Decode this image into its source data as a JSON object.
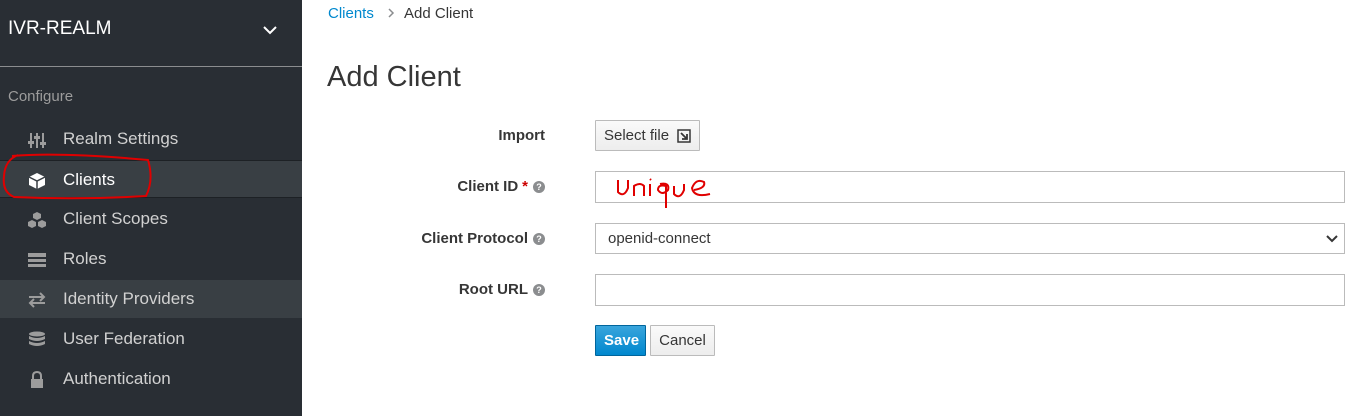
{
  "sidebar": {
    "realm_name": "IVR-REALM",
    "section_label": "Configure",
    "items": [
      {
        "label": "Realm Settings",
        "icon": "sliders-icon"
      },
      {
        "label": "Clients",
        "icon": "cube-icon"
      },
      {
        "label": "Client Scopes",
        "icon": "cubes-icon"
      },
      {
        "label": "Roles",
        "icon": "list-icon"
      },
      {
        "label": "Identity Providers",
        "icon": "exchange-icon"
      },
      {
        "label": "User Federation",
        "icon": "database-icon"
      },
      {
        "label": "Authentication",
        "icon": "lock-icon"
      }
    ]
  },
  "breadcrumb": {
    "link": "Clients",
    "current": "Add Client"
  },
  "page_title": "Add Client",
  "form": {
    "import_label": "Import",
    "select_file_label": "Select file",
    "client_id_label": "Client ID",
    "client_id_required_mark": "*",
    "client_id_annotation": "Unique",
    "client_protocol_label": "Client Protocol",
    "client_protocol_value": "openid-connect",
    "root_url_label": "Root URL",
    "save_label": "Save",
    "cancel_label": "Cancel"
  },
  "colors": {
    "sidebar_bg": "#292e34",
    "link": "#0088ce",
    "primary": "#0088ce",
    "annotation": "#e00000"
  }
}
